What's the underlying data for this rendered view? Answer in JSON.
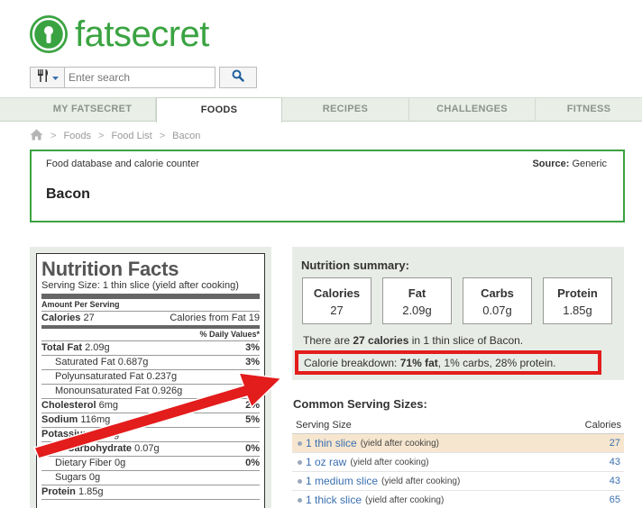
{
  "brand": {
    "name": "fatsecret",
    "color": "#3aa341"
  },
  "search": {
    "placeholder": "Enter search",
    "category_icon": "fork-knife-icon",
    "button_icon": "search-icon"
  },
  "nav": {
    "tabs": [
      "MY FATSECRET",
      "FOODS",
      "RECIPES",
      "CHALLENGES",
      "FITNESS"
    ],
    "active": "FOODS"
  },
  "breadcrumb": {
    "home_icon": "home-icon",
    "items": [
      "Foods",
      "Food List",
      "Bacon"
    ]
  },
  "food": {
    "subtitle": "Food database and calorie counter",
    "source_label": "Source:",
    "source_value": "Generic",
    "name": "Bacon"
  },
  "nutrition_facts": {
    "title": "Nutrition Facts",
    "serving": "Serving Size: 1 thin slice (yield after cooking)",
    "amount_per": "Amount Per Serving",
    "calories_label": "Calories",
    "calories_value": "27",
    "cal_from_fat": "Calories from Fat 19",
    "dv_header": "% Daily Values*",
    "rows": [
      {
        "label": "Total Fat",
        "amount": "2.09g",
        "dv": "3%"
      },
      {
        "label": "Saturated Fat",
        "amount": "0.687g",
        "dv": "3%"
      },
      {
        "label": "Polyunsaturated Fat",
        "amount": "0.237g",
        "dv": ""
      },
      {
        "label": "Monounsaturated Fat",
        "amount": "0.926g",
        "dv": ""
      },
      {
        "label": "Cholesterol",
        "amount": "6mg",
        "dv": "2%"
      },
      {
        "label": "Sodium",
        "amount": "116mg",
        "dv": "5%"
      },
      {
        "label": "Potassium",
        "amount": "28mg",
        "dv": ""
      },
      {
        "label": "Total Carbohydrate",
        "amount": "0.07g",
        "dv": "0%"
      },
      {
        "label": "Dietary Fiber",
        "amount": "0g",
        "dv": "0%"
      },
      {
        "label": "Sugars",
        "amount": "0g",
        "dv": ""
      },
      {
        "label": "Protein",
        "amount": "1.85g",
        "dv": ""
      }
    ]
  },
  "summary": {
    "title": "Nutrition summary:",
    "boxes": [
      {
        "label": "Calories",
        "value": "27"
      },
      {
        "label": "Fat",
        "value": "2.09g"
      },
      {
        "label": "Carbs",
        "value": "0.07g"
      },
      {
        "label": "Protein",
        "value": "1.85g"
      }
    ],
    "line_prefix": "There are ",
    "line_bold": "27 calories",
    "line_suffix": " in 1 thin slice of Bacon.",
    "breakdown_prefix": "Calorie breakdown: ",
    "breakdown_bold": "71% fat",
    "breakdown_suffix": ", 1% carbs, 28% protein.",
    "highlight_color": "#e31c1c"
  },
  "serving_sizes": {
    "title": "Common Serving Sizes:",
    "col_size": "Serving Size",
    "col_cal": "Calories",
    "rows": [
      {
        "size": "1 thin slice",
        "note": "(yield after cooking)",
        "calories": "27"
      },
      {
        "size": "1 oz raw",
        "note": "(yield after cooking)",
        "calories": "43"
      },
      {
        "size": "1 medium slice",
        "note": "(yield after cooking)",
        "calories": "43"
      },
      {
        "size": "1 thick slice",
        "note": "(yield after cooking)",
        "calories": "65"
      }
    ]
  }
}
